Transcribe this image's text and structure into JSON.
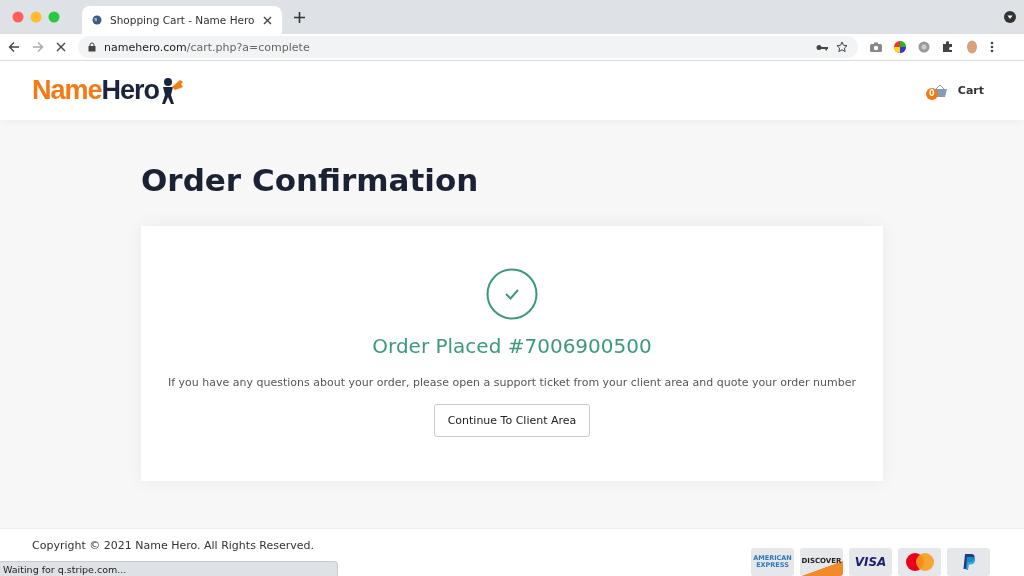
{
  "browser": {
    "tab_title": "Shopping Cart - Name Hero",
    "url_host": "namehero.com",
    "url_path": "/cart.php?a=complete",
    "status": "Waiting for q.stripe.com..."
  },
  "header": {
    "logo_first": "Name",
    "logo_second": "Hero",
    "cart_count": "0",
    "cart_label": "Cart"
  },
  "page": {
    "title": "Order Confirmation",
    "order_heading": "Order Placed #7006900500",
    "message": "If you have any questions about your order, please open a support ticket from your client area and quote your order number",
    "button": "Continue To Client Area"
  },
  "footer": {
    "copyright": "Copyright © 2021 Name Hero. All Rights Reserved.",
    "payment_cards": [
      {
        "kind": "amex",
        "label": "AMERICAN EXPRESS"
      },
      {
        "kind": "discover",
        "label": "DISCOVER"
      },
      {
        "kind": "visa",
        "label": "VISA"
      },
      {
        "kind": "mastercard"
      },
      {
        "kind": "paypal"
      }
    ]
  }
}
